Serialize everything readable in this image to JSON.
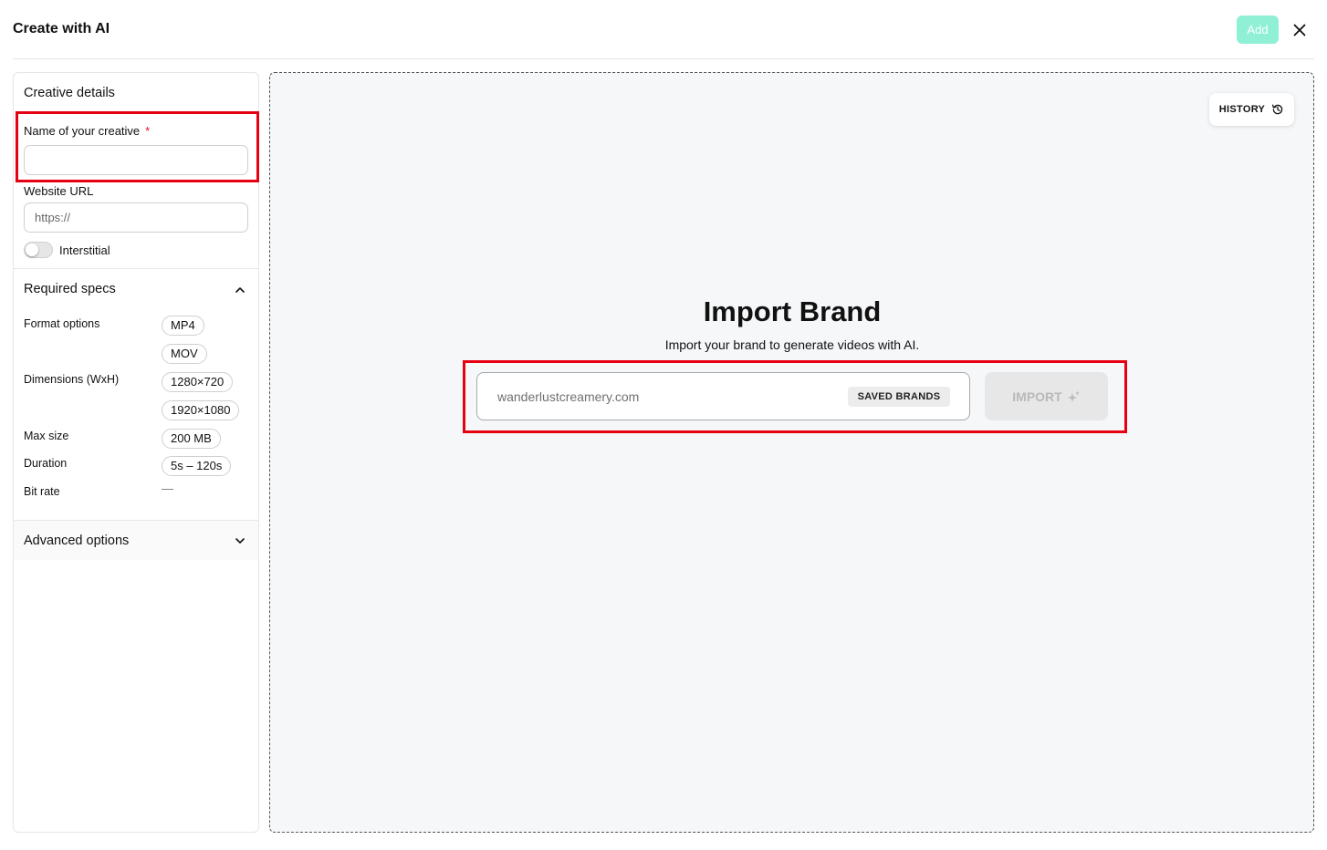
{
  "header": {
    "title": "Create with AI",
    "add_label": "Add",
    "colors": {
      "add_button_bg": "#8ff0d6",
      "add_button_text": "#ffffff"
    }
  },
  "icons": {
    "close": "close-icon",
    "history": "history-icon",
    "sparkle": "sparkle-icon",
    "collapse": "chevron-up-icon",
    "expand": "chevron-down-icon"
  },
  "creative_details": {
    "title": "Creative details",
    "name_label": "Name of your creative",
    "required_marker": "*",
    "name_value": "",
    "website_label": "Website URL",
    "website_placeholder": "https://",
    "website_value": "",
    "interstitial_label": "Interstitial",
    "interstitial_enabled": false
  },
  "required_specs": {
    "title": "Required specs",
    "expanded": true,
    "format_label": "Format options",
    "formats": [
      "MP4",
      "MOV"
    ],
    "dimensions_label": "Dimensions (WxH)",
    "dimensions": [
      "1280×720",
      "1920×1080"
    ],
    "max_size_label": "Max size",
    "max_size": "200 MB",
    "duration_label": "Duration",
    "duration": "5s – 120s",
    "bit_rate_label": "Bit rate",
    "bit_rate": "—"
  },
  "advanced_options": {
    "title": "Advanced options",
    "expanded": false
  },
  "main": {
    "history_label": "HISTORY",
    "title": "Import Brand",
    "subtitle": "Import your brand to generate videos with AI.",
    "brand_input_placeholder": "wanderlustcreamery.com",
    "brand_input_value": "",
    "saved_brands_label": "SAVED BRANDS",
    "import_label": "IMPORT",
    "import_enabled": false
  },
  "highlight_color": "#e60012"
}
